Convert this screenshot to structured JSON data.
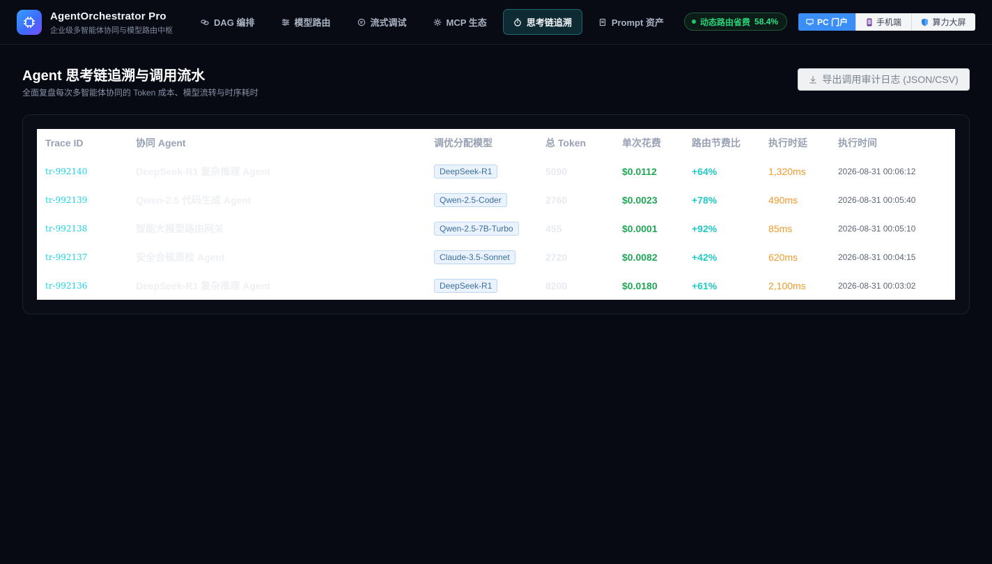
{
  "brand": {
    "title": "AgentOrchestrator Pro",
    "subtitle": "企业级多智能体协同与模型路由中枢"
  },
  "nav": [
    {
      "label": "DAG 编排",
      "icon": "link-icon",
      "active": false
    },
    {
      "label": "模型路由",
      "icon": "sliders-icon",
      "active": false
    },
    {
      "label": "流式调试",
      "icon": "chat-icon",
      "active": false
    },
    {
      "label": "MCP 生态",
      "icon": "gear-icon",
      "active": false
    },
    {
      "label": "思考链追溯",
      "icon": "stopwatch-icon",
      "active": true
    },
    {
      "label": "Prompt 资产",
      "icon": "document-icon",
      "active": false
    }
  ],
  "savings": {
    "label": "动态路由省费",
    "value": "58.4%",
    "color": "#2bd17a"
  },
  "views": [
    {
      "label": "PC 门户",
      "icon": "monitor-icon",
      "active": true
    },
    {
      "label": "手机端",
      "icon": "phone-icon",
      "active": false
    },
    {
      "label": "算力大屏",
      "icon": "shield-icon",
      "active": false
    }
  ],
  "page": {
    "title": "Agent 思考链追溯与调用流水",
    "subtitle": "全面复盘每次多智能体协同的 Token 成本、模型流转与时序耗时",
    "export_label": "导出调用审计日志 (JSON/CSV)"
  },
  "table": {
    "headers": [
      "Trace ID",
      "协同 Agent",
      "调优分配模型",
      "总 Token",
      "单次花费",
      "路由节费比",
      "执行时延",
      "执行时间"
    ],
    "rows": [
      {
        "id": "tr-992140",
        "agent": "DeepSeek-R1 复杂推理 Agent",
        "model": "DeepSeek-R1",
        "tokens": "5090",
        "cost": "$0.0112",
        "ratio": "+64%",
        "latency": "1,320ms",
        "time": "2026-08-31 00:06:12"
      },
      {
        "id": "tr-992139",
        "agent": "Qwen-2.5 代码生成 Agent",
        "model": "Qwen-2.5-Coder",
        "tokens": "2760",
        "cost": "$0.0023",
        "ratio": "+78%",
        "latency": "490ms",
        "time": "2026-08-31 00:05:40"
      },
      {
        "id": "tr-992138",
        "agent": "智能大模型路由网关",
        "model": "Qwen-2.5-7B-Turbo",
        "tokens": "455",
        "cost": "$0.0001",
        "ratio": "+92%",
        "latency": "85ms",
        "time": "2026-08-31 00:05:10"
      },
      {
        "id": "tr-992137",
        "agent": "安全合规质检 Agent",
        "model": "Claude-3.5-Sonnet",
        "tokens": "2720",
        "cost": "$0.0082",
        "ratio": "+42%",
        "latency": "620ms",
        "time": "2026-08-31 00:04:15"
      },
      {
        "id": "tr-992136",
        "agent": "DeepSeek-R1 复杂推理 Agent",
        "model": "DeepSeek-R1",
        "tokens": "8200",
        "cost": "$0.0180",
        "ratio": "+61%",
        "latency": "2,100ms",
        "time": "2026-08-31 00:03:02"
      }
    ]
  }
}
